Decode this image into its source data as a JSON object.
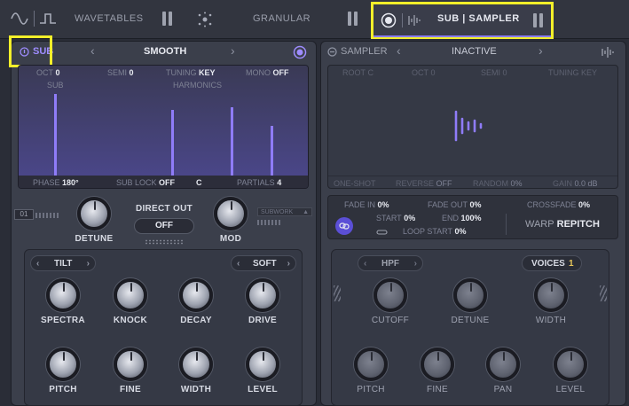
{
  "topbar": {
    "wavetables": "WAVETABLES",
    "granular": "GRANULAR",
    "sub_sampler": "SUB | SAMPLER",
    "wave_icon": "sine-wave-icon",
    "square_icon": "square-wave-icon"
  },
  "sub": {
    "label": "SUB",
    "preset": "SMOOTH",
    "params_top": {
      "oct_label": "OCT",
      "oct_value": "0",
      "semi_label": "SEMI",
      "semi_value": "0",
      "tuning_label": "TUNING",
      "tuning_value": "KEY",
      "mono_label": "MONO",
      "mono_value": "OFF"
    },
    "display_sub": "SUB",
    "display_harmonics": "HARMONICS",
    "params_bottom": {
      "phase_label": "PHASE",
      "phase_value": "180°",
      "sublock_label": "SUB LOCK",
      "sublock_value": "OFF",
      "note_value": "C",
      "partials_label": "PARTIALS",
      "partials_value": "4"
    },
    "slot_number": "01",
    "subwork": "SUBWORK",
    "detune": "DETUNE",
    "direct_out": "DIRECT OUT",
    "direct_out_value": "OFF",
    "mod": "MOD",
    "tilt": "TILT",
    "soft": "SOFT",
    "knobs_row1": [
      "SPECTRA",
      "KNOCK",
      "DECAY",
      "DRIVE"
    ],
    "knobs_row2": [
      "PITCH",
      "FINE",
      "WIDTH",
      "LEVEL"
    ]
  },
  "sampler": {
    "label": "SAMPLER",
    "preset": "INACTIVE",
    "params_top": {
      "root_label": "ROOT",
      "root_value": "C",
      "oct_label": "OCT",
      "oct_value": "0",
      "semi_label": "SEMI",
      "semi_value": "0",
      "tuning_label": "TUNING",
      "tuning_value": "KEY"
    },
    "params_bottom": {
      "oneshot": "ONE-SHOT",
      "reverse_label": "REVERSE",
      "reverse_value": "OFF",
      "random_label": "RANDOM",
      "random_value": "0%",
      "gain_label": "GAIN",
      "gain_value": "0.0 dB"
    },
    "fade_in_label": "FADE IN",
    "fade_in_value": "0%",
    "fade_out_label": "FADE OUT",
    "fade_out_value": "0%",
    "crossfade_label": "CROSSFADE",
    "crossfade_value": "0%",
    "start_label": "START",
    "start_value": "0%",
    "end_label": "END",
    "end_value": "100%",
    "loop_start_label": "LOOP START",
    "loop_start_value": "0%",
    "warp_label": "WARP",
    "warp_value": "REPITCH",
    "hpf": "HPF",
    "voices_label": "VOICES",
    "voices_value": "1",
    "knobs_row1": [
      "CUTOFF",
      "DETUNE",
      "WIDTH"
    ],
    "knobs_row2": [
      "PITCH",
      "FINE",
      "PAN",
      "LEVEL"
    ]
  }
}
